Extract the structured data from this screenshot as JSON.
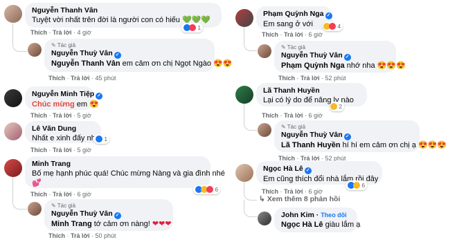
{
  "left": [
    {
      "name": "Nguyễn Thanh Vân",
      "text": "Tuyệt vời nhất trên đời là người con có hiếu",
      "emoji": "💚💚💚",
      "actions": {
        "like": "Thích",
        "reply": "Trả lời",
        "time": "4 giờ"
      },
      "reactions": "1"
    },
    {
      "author_tag": "Tác giả",
      "name": "Nguyễn Thuỳ Vân",
      "mention": "Nguyễn Thanh Vân",
      "text": " em cảm ơn chị Ngọt Ngào ",
      "emoji": "😍😍",
      "actions": {
        "like": "Thích",
        "reply": "Trả lời",
        "time": "45 phút"
      }
    },
    {
      "name": "Nguyễn Minh Tiệp",
      "red_text": "Chúc mừng",
      "text": " em ",
      "emoji": "😍",
      "actions": {
        "like": "Thích",
        "reply": "Trả lời",
        "time": "5 giờ"
      }
    },
    {
      "name": "Lê Văn Dung",
      "text": "Nhất e xinh đấy nha",
      "actions": {
        "like": "Thích",
        "reply": "Trả lời",
        "time": "5 giờ"
      },
      "reactions": "1"
    },
    {
      "name": "Minh Trang",
      "text": "Bố mẹ hạnh phúc quá! Chúc mừng Nàng và gia đình nhé",
      "emoji2": "💕",
      "actions": {
        "like": "Thích",
        "reply": "Trả lời",
        "time": "6 giờ"
      },
      "reactions": "6"
    },
    {
      "author_tag": "Tác giả",
      "name": "Nguyễn Thuỳ Vân",
      "mention": "Minh Trang",
      "text": " tớ cảm ơn nàng! ",
      "emoji": "❤❤❤",
      "actions": {
        "like": "Thích",
        "reply": "Trả lời",
        "time": "50 phút"
      }
    }
  ],
  "right": [
    {
      "name": "Phạm Quỳnh Nga",
      "text": "Em sang ở với",
      "actions": {
        "like": "Thích",
        "reply": "Trả lời",
        "time": "6 giờ"
      },
      "reactions": "4"
    },
    {
      "author_tag": "Tác giả",
      "name": "Nguyễn Thuỳ Vân",
      "mention": "Phạm Quỳnh Nga",
      "text": " nhớ nha ",
      "emoji": "😍😍😍",
      "actions": {
        "like": "Thích",
        "reply": "Trả lời",
        "time": "52 phút"
      }
    },
    {
      "name": "Lã Thanh Huyền",
      "text": "Lại có lý do để nâng ly nào",
      "actions": {
        "like": "Thích",
        "reply": "Trả lời",
        "time": "6 giờ"
      },
      "reactions": "2"
    },
    {
      "author_tag": "Tác giả",
      "name": "Nguyễn Thuỳ Vân",
      "mention": "Lã Thanh Huyền",
      "text": " hí hí em cảm ơn chị ạ ",
      "emoji": "😍😍😍",
      "actions": {
        "like": "Thích",
        "reply": "Trả lời",
        "time": "52 phút"
      }
    },
    {
      "name": "Ngọc Hà Lê",
      "text": "Em cũng thích đổi nhà lắm rồi đây",
      "actions": {
        "like": "Thích",
        "reply": "Trả lời",
        "time": "6 giờ"
      },
      "reactions": "6"
    },
    {
      "name": "John Kim",
      "follow": "Theo dõi",
      "mention": "Ngọc Hà Lê",
      "text": " giàu lắm ạ"
    }
  ],
  "more_replies": "Xem thêm 8 phản hồi",
  "dot": "·",
  "verified_mark": "✓"
}
